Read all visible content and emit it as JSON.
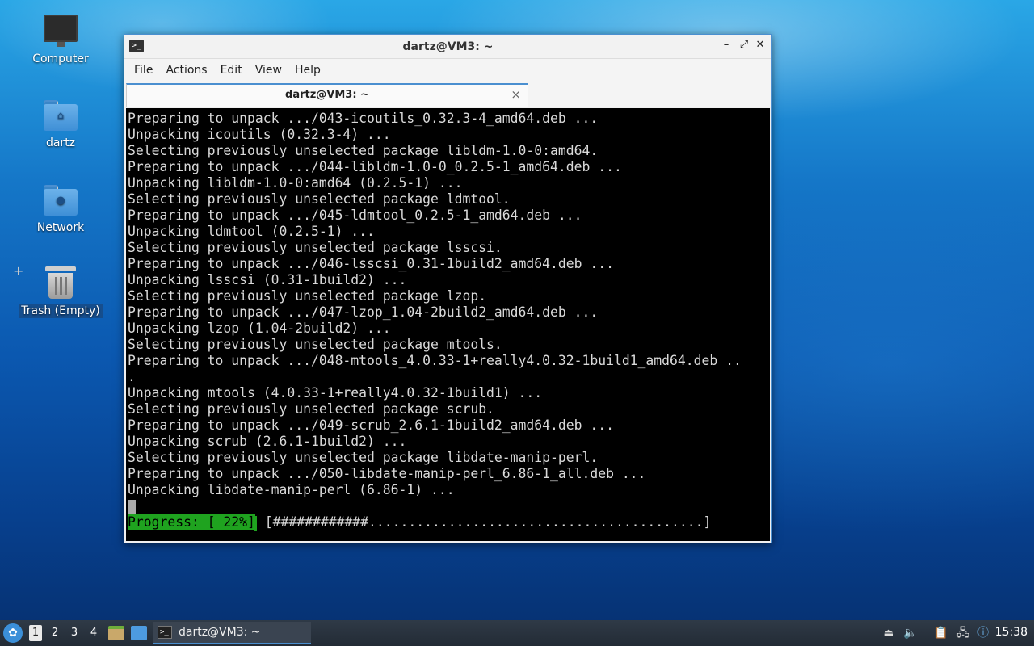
{
  "desktop": {
    "icons": [
      {
        "label": "Computer"
      },
      {
        "label": "dartz"
      },
      {
        "label": "Network"
      },
      {
        "label": "Trash (Empty)"
      }
    ]
  },
  "window": {
    "title": "dartz@VM3: ~",
    "menu": [
      "File",
      "Actions",
      "Edit",
      "View",
      "Help"
    ],
    "tab_label": "dartz@VM3: ~",
    "terminal_lines": [
      "Preparing to unpack .../043-icoutils_0.32.3-4_amd64.deb ...",
      "Unpacking icoutils (0.32.3-4) ...",
      "Selecting previously unselected package libldm-1.0-0:amd64.",
      "Preparing to unpack .../044-libldm-1.0-0_0.2.5-1_amd64.deb ...",
      "Unpacking libldm-1.0-0:amd64 (0.2.5-1) ...",
      "Selecting previously unselected package ldmtool.",
      "Preparing to unpack .../045-ldmtool_0.2.5-1_amd64.deb ...",
      "Unpacking ldmtool (0.2.5-1) ...",
      "Selecting previously unselected package lsscsi.",
      "Preparing to unpack .../046-lsscsi_0.31-1build2_amd64.deb ...",
      "Unpacking lsscsi (0.31-1build2) ...",
      "Selecting previously unselected package lzop.",
      "Preparing to unpack .../047-lzop_1.04-2build2_amd64.deb ...",
      "Unpacking lzop (1.04-2build2) ...",
      "Selecting previously unselected package mtools.",
      "Preparing to unpack .../048-mtools_4.0.33-1+really4.0.32-1build1_amd64.deb ..",
      ".",
      "Unpacking mtools (4.0.33-1+really4.0.32-1build1) ...",
      "Selecting previously unselected package scrub.",
      "Preparing to unpack .../049-scrub_2.6.1-1build2_amd64.deb ...",
      "Unpacking scrub (2.6.1-1build2) ...",
      "Selecting previously unselected package libdate-manip-perl.",
      "Preparing to unpack .../050-libdate-manip-perl_6.86-1_all.deb ...",
      "Unpacking libdate-manip-perl (6.86-1) ..."
    ],
    "progress_label": "Progress: [ 22%]",
    "progress_bar": " [############..........................................]",
    "progress_percent": 22
  },
  "taskbar": {
    "workspaces": [
      "1",
      "2",
      "3",
      "4"
    ],
    "active_workspace": "1",
    "task_label": "dartz@VM3: ~",
    "clock": "15:38"
  }
}
